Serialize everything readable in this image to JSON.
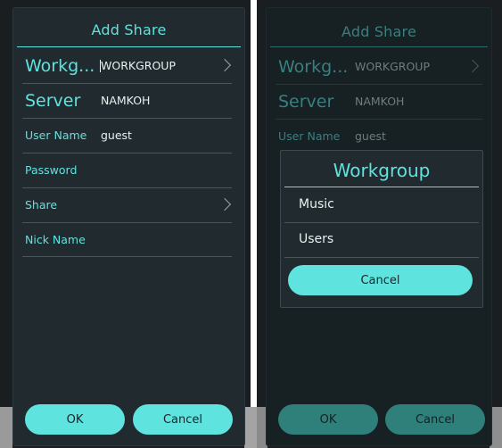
{
  "left": {
    "title": "Add Share",
    "fields": {
      "workgroup": {
        "label": "Workg...",
        "value": "WORKGROUP"
      },
      "server": {
        "label": "Server",
        "value": "NAMKOH"
      },
      "username": {
        "label": "User Name",
        "value": "guest"
      },
      "password": {
        "label": "Password",
        "value": ""
      },
      "share": {
        "label": "Share",
        "value": ""
      },
      "nickname": {
        "label": "Nick Name",
        "value": ""
      }
    },
    "ok_label": "OK",
    "cancel_label": "Cancel"
  },
  "right": {
    "title": "Add Share",
    "fields": {
      "workgroup": {
        "label": "Workg...",
        "value": "WORKGROUP"
      },
      "server": {
        "label": "Server",
        "value": "NAMKOH"
      },
      "username": {
        "label": "User Name",
        "value": "guest"
      }
    },
    "ok_label": "OK",
    "cancel_label": "Cancel",
    "dialog": {
      "title": "Workgroup",
      "options": [
        "Music",
        "Users"
      ],
      "cancel_label": "Cancel"
    }
  },
  "colors": {
    "accent": "#5fe3df",
    "button": "#5fe3df",
    "button_dim": "#2f7f7b",
    "panel": "#212a2e",
    "text": "#e9f0f0"
  }
}
